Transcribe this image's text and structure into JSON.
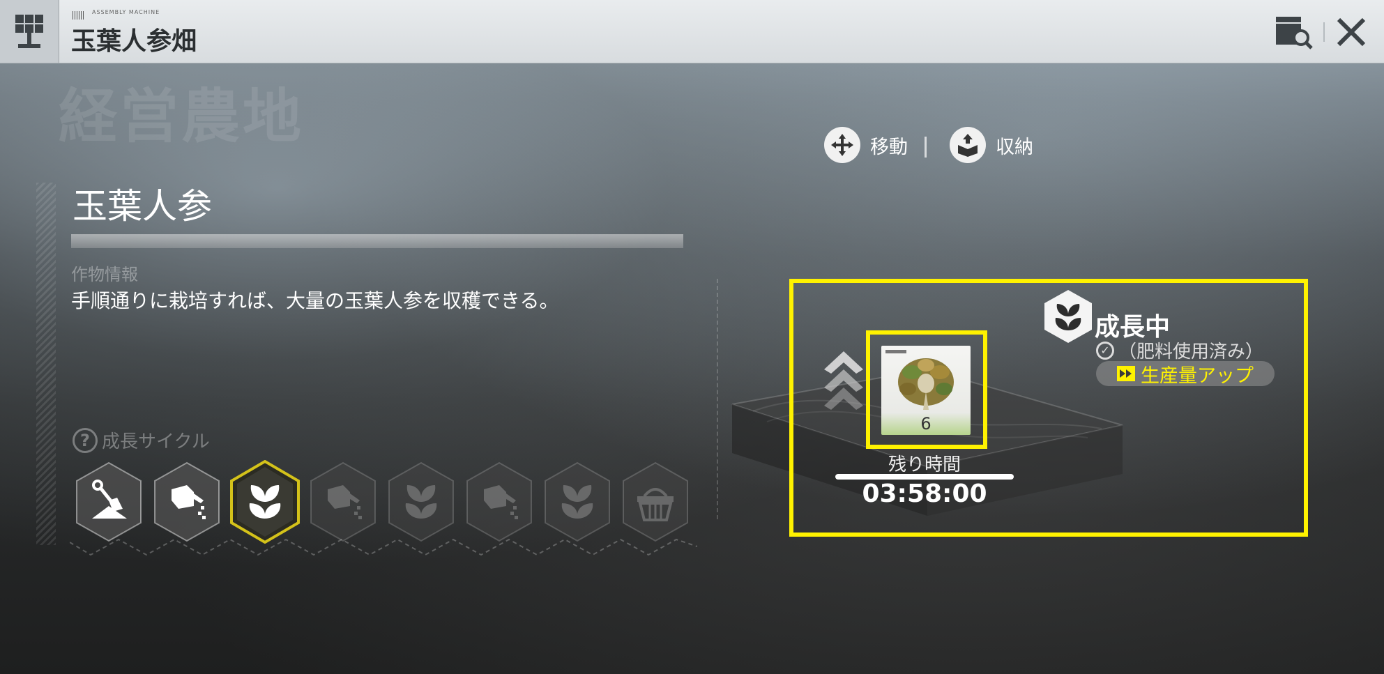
{
  "header": {
    "title": "玉葉人参畑",
    "tiny_label": "ASSEMBLY MACHINE"
  },
  "watermark": "経営農地",
  "actions": {
    "move_label": "移動",
    "store_label": "収納"
  },
  "crop": {
    "name": "玉葉人参",
    "info_label": "作物情報",
    "description": "手順通りに栽培すれば、大量の玉葉人参を収穫できる。"
  },
  "cycle": {
    "label": "成長サイクル",
    "steps": [
      {
        "icon": "shovel-icon",
        "state": "done"
      },
      {
        "icon": "watering-can-icon",
        "state": "done"
      },
      {
        "icon": "sprout-icon",
        "state": "current"
      },
      {
        "icon": "watering-can-icon",
        "state": "pending"
      },
      {
        "icon": "sprout-icon",
        "state": "pending"
      },
      {
        "icon": "watering-can-icon",
        "state": "pending"
      },
      {
        "icon": "sprout-icon",
        "state": "pending"
      },
      {
        "icon": "basket-icon",
        "state": "pending"
      }
    ]
  },
  "status": {
    "title": "成長中",
    "fertilizer": "（肥料使用済み）",
    "boost": "生産量アップ",
    "item_count": "6",
    "remaining_label": "残り時間",
    "remaining_time": "03:58:00",
    "highlight_color": "#fff200"
  }
}
